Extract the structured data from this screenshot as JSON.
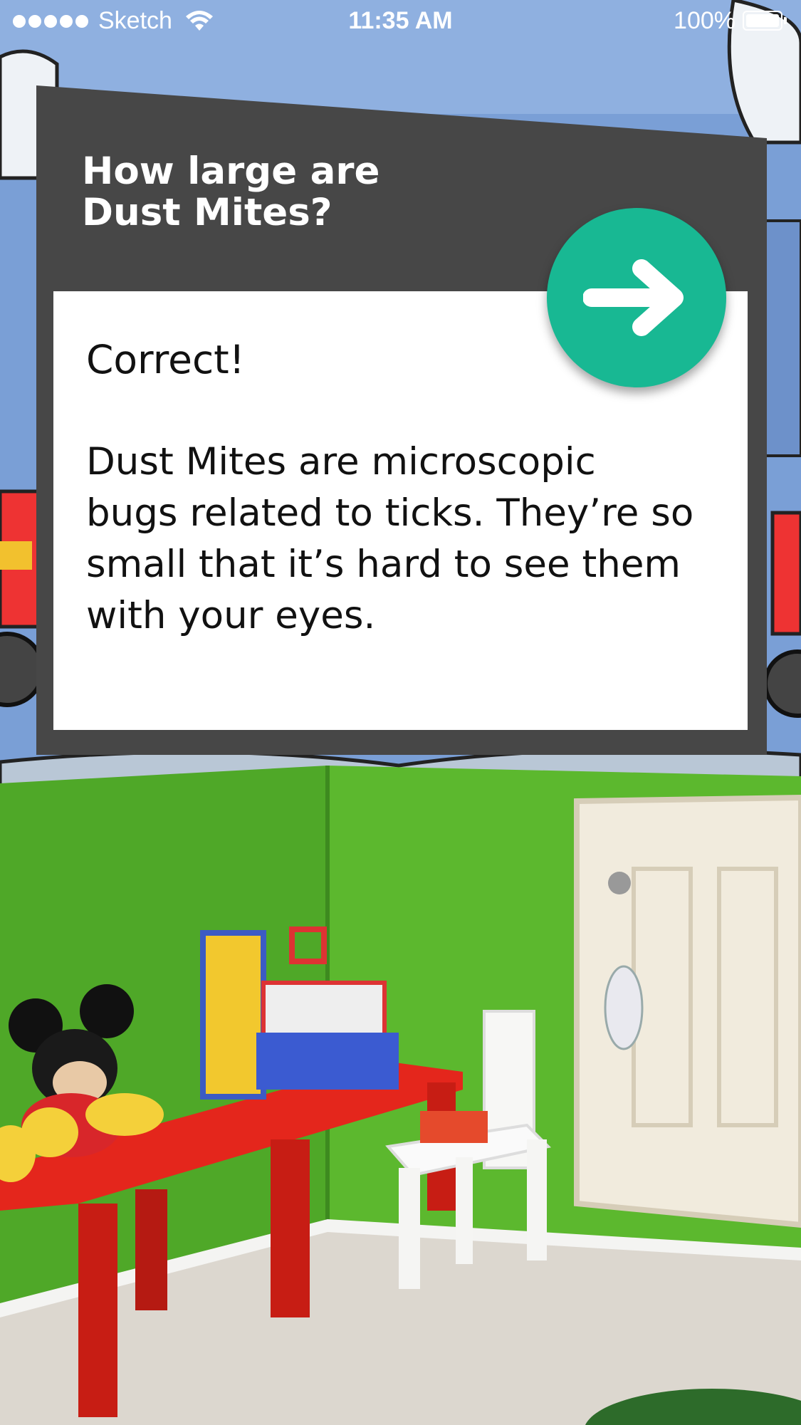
{
  "status_bar": {
    "carrier": "Sketch",
    "time": "11:35 AM",
    "battery": "100%",
    "icons": [
      "signal-dots-icon",
      "wifi-icon",
      "battery-icon"
    ]
  },
  "card": {
    "title": "How large are Dust Mites?",
    "result": "Correct!",
    "explanation": "Dust Mites are microscopic bugs related to ticks. They’re so small that it’s hard to see them with your eyes.",
    "next_icon": "arrow-right-icon"
  },
  "colors": {
    "card_dark": "#474747",
    "card_body": "#ffffff",
    "next_button": "#18b893",
    "text": "#111111"
  },
  "background": {
    "description_icon": "playroom-photo"
  }
}
